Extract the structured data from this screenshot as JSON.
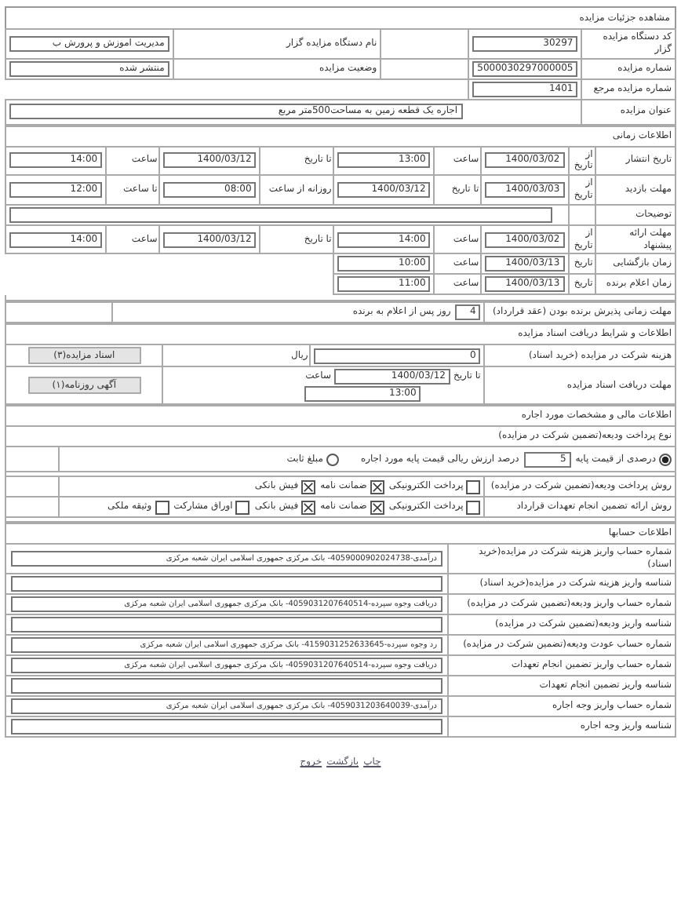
{
  "title": "مشاهده جزئیات مزایده",
  "header": [
    {
      "label": "کد دستگاه مزایده گزار",
      "value": "30297",
      "label_2": "نام دستگاه مزایده گزار",
      "value_2": "مدیریت اموزش و پرورش ب"
    },
    {
      "label": "شماره مزایده",
      "value": "5000030297000005",
      "label_2": "وضعیت مزایده",
      "value_2": "منتشر شده"
    },
    {
      "label": "شماره مزایده مرجع",
      "value": "1401"
    }
  ],
  "auction_title": {
    "label": "عنوان مزایده",
    "value": "اجاره یک قطعه زمین به مساحت500متر مربع"
  },
  "timing": {
    "heading": "اطلاعات زمانی",
    "rows": [
      {
        "label": "تاریخ انتشار",
        "items": [
          {
            "kind": "caption",
            "text": "از تاریخ"
          },
          {
            "kind": "field",
            "value": "1400/03/02"
          },
          {
            "kind": "caption",
            "text": "ساعت"
          },
          {
            "kind": "field",
            "value": "13:00"
          },
          {
            "kind": "caption",
            "text": "تا تاریخ"
          },
          {
            "kind": "field",
            "value": "1400/03/12"
          },
          {
            "kind": "caption",
            "text": "ساعت"
          },
          {
            "kind": "field",
            "value": "14:00"
          }
        ]
      },
      {
        "label": "مهلت بازدید",
        "items": [
          {
            "kind": "caption",
            "text": "از تاریخ"
          },
          {
            "kind": "field",
            "value": "1400/03/03"
          },
          {
            "kind": "caption",
            "text": "تا تاریخ"
          },
          {
            "kind": "field",
            "value": "1400/03/12"
          },
          {
            "kind": "caption",
            "text": "روزانه از ساعت"
          },
          {
            "kind": "field",
            "value": "08:00"
          },
          {
            "kind": "caption",
            "text": "تا ساعت"
          },
          {
            "kind": "field",
            "value": "12:00"
          }
        ]
      },
      {
        "label": "توضیحات",
        "items": [
          {
            "kind": "wide_field"
          }
        ]
      },
      {
        "label": "مهلت ارائه پیشنهاد",
        "items": [
          {
            "kind": "caption",
            "text": "از تاریخ"
          },
          {
            "kind": "field",
            "value": "1400/03/02"
          },
          {
            "kind": "caption",
            "text": "ساعت"
          },
          {
            "kind": "field",
            "value": "14:00"
          },
          {
            "kind": "caption",
            "text": "تا تاریخ"
          },
          {
            "kind": "field",
            "value": "1400/03/12"
          },
          {
            "kind": "caption",
            "text": "ساعت"
          },
          {
            "kind": "field",
            "value": "14:00"
          }
        ]
      },
      {
        "label": "زمان بازگشایی",
        "items": [
          {
            "kind": "caption",
            "text": "تاریخ"
          },
          {
            "kind": "field",
            "value": "1400/03/13"
          },
          {
            "kind": "caption",
            "text": "ساعت"
          },
          {
            "kind": "field",
            "value": "10:00"
          }
        ]
      },
      {
        "label": "زمان اعلام برنده",
        "items": [
          {
            "kind": "caption",
            "text": "تاریخ"
          },
          {
            "kind": "field",
            "value": "1400/03/13"
          },
          {
            "kind": "caption",
            "text": "ساعت"
          },
          {
            "kind": "field",
            "value": "11:00"
          }
        ]
      }
    ]
  },
  "acceptance": {
    "label": "مهلت زمانی پذیرش برنده بودن (عقد قرارداد)",
    "value": "4",
    "suffix": "روز پس از اعلام به برنده"
  },
  "documents": {
    "heading": "اطلاعات و شرایط دریافت اسناد مزایده",
    "fee": {
      "label": "هزینه شرکت در مزایده (خرید اسناد)",
      "value": "0",
      "unit": "ریال",
      "button": "اسناد مزایده(۳)"
    },
    "deadline": {
      "label": "مهلت دریافت اسناد مزایده",
      "date_caption": "تا تاریخ",
      "date": "1400/03/12",
      "time_caption": "ساعت",
      "time": "13:00",
      "button": "آگهی روزنامه(۱)"
    }
  },
  "financial": {
    "heading": "اطلاعات مالی و مشخصات مورد اجاره",
    "deposit_type_label": "نوع پرداخت ودیعه(تضمین شرکت در مزایده)",
    "options": [
      {
        "kind": "value_option",
        "text_before": "درصدی از قیمت پایه",
        "value": "5",
        "text_after": "درصد ارزش ریالی قیمت پایه مورد اجاره",
        "selected": true
      },
      {
        "kind": "plain_option",
        "text": "مبلغ ثابت",
        "selected": false
      }
    ],
    "deposit_methods": {
      "label": "روش پرداخت ودیعه(تضمین شرکت در مزایده)",
      "options": [
        {
          "text": "پرداخت الکترونیکی",
          "checked": false
        },
        {
          "text": "ضمانت نامه",
          "checked": true
        },
        {
          "text": "فیش بانکی",
          "checked": true
        }
      ]
    },
    "guarantee_methods": {
      "label": "روش ارائه تضمین انجام تعهدات قرارداد",
      "options": [
        {
          "text": "پرداخت الکترونیکی",
          "checked": false
        },
        {
          "text": "ضمانت نامه",
          "checked": true
        },
        {
          "text": "فیش بانکی",
          "checked": true
        },
        {
          "text": "اوراق مشارکت",
          "checked": false
        },
        {
          "text": "وثیقه ملکی",
          "checked": false
        }
      ]
    }
  },
  "accounts": {
    "heading": "اطلاعات حسابها",
    "rows": [
      {
        "label": "شماره حساب واریز هزینه شرکت در مزایده(خرید اسناد)",
        "value": "درآمدی-4059000902024738- بانک مرکزی جمهوری اسلامی ایران شعبه مرکزی"
      },
      {
        "label": "شناسه واریز هزینه شرکت در مزایده(خرید اسناد)"
      },
      {
        "label": "شماره حساب واریز ودیعه(تضمین شرکت در مزایده)",
        "value": "دریافت وجوه سپرده-4059031207640514- بانک مرکزی جمهوری اسلامی ایران شعبه مرکزی"
      },
      {
        "label": "شناسه واریز ودیعه(تضمین شرکت در مزایده)"
      },
      {
        "label": "شماره حساب عودت ودیعه(تضمین شرکت در مزایده)",
        "value": "رد وجوه سپرده-4159031252633645- بانک مرکزی جمهوری اسلامی ایران شعبه مرکزی"
      },
      {
        "label": "شماره حساب واریز تضمین انجام تعهدات",
        "value": "دریافت وجوه سپرده-4059031207640514- بانک مرکزی جمهوری اسلامی ایران شعبه مرکزی"
      },
      {
        "label": "شناسه واریز تضمین انجام تعهدات"
      },
      {
        "label": "شماره حساب واریز وجه اجاره",
        "value": "درآمدی-4059031203640039- بانک مرکزی جمهوری اسلامی ایران شعبه مرکزی"
      },
      {
        "label": "شناسه واریز وجه اجاره"
      }
    ]
  },
  "footer_links": [
    "چاپ",
    "بازگشت",
    "خروج"
  ]
}
